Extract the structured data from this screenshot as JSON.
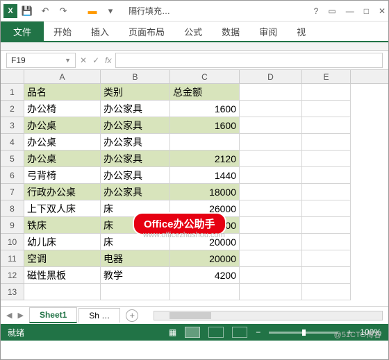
{
  "app": {
    "icon_letter": "X",
    "title": "隔行填充…"
  },
  "qat": {
    "save": "💾",
    "undo": "↶",
    "redo": "↷"
  },
  "ribbon": {
    "file": "文件",
    "tabs": [
      "开始",
      "插入",
      "页面布局",
      "公式",
      "数据",
      "审阅",
      "视"
    ]
  },
  "namebox": {
    "ref": "F19",
    "fx": "fx"
  },
  "columns": [
    "A",
    "B",
    "C",
    "D",
    "E"
  ],
  "row_nums": [
    "1",
    "2",
    "3",
    "4",
    "5",
    "6",
    "7",
    "8",
    "9",
    "10",
    "11",
    "12",
    "13"
  ],
  "headers": {
    "c1": "品名",
    "c2": "类别",
    "c3": "总金额"
  },
  "rows": [
    {
      "name": "办公椅",
      "cat": "办公家具",
      "amt": "1600",
      "shade": false
    },
    {
      "name": "办公桌",
      "cat": "办公家具",
      "amt": "1600",
      "shade": true
    },
    {
      "name": "办公桌",
      "cat": "办公家具",
      "amt": "",
      "shade": false
    },
    {
      "name": "办公桌",
      "cat": "办公家具",
      "amt": "2120",
      "shade": true
    },
    {
      "name": "弓背椅",
      "cat": "办公家具",
      "amt": "1440",
      "shade": false
    },
    {
      "name": "行政办公桌",
      "cat": "办公家具",
      "amt": "18000",
      "shade": true
    },
    {
      "name": "上下双人床",
      "cat": "床",
      "amt": "26000",
      "shade": false
    },
    {
      "name": "铁床",
      "cat": "床",
      "amt": "30000",
      "shade": true
    },
    {
      "name": "幼儿床",
      "cat": "床",
      "amt": "20000",
      "shade": false
    },
    {
      "name": "空调",
      "cat": "电器",
      "amt": "20000",
      "shade": true
    },
    {
      "name": "磁性黑板",
      "cat": "教学",
      "amt": "4200",
      "shade": false
    }
  ],
  "overlay": {
    "badge": "Office办公助手",
    "url": "www.officezhushou.com"
  },
  "sheets": {
    "active": "Sheet1",
    "other": "Sh …",
    "add": "+"
  },
  "status": {
    "ready": "就绪",
    "zoom": "100%",
    "minus": "−",
    "plus": "+"
  },
  "watermark": "@51CTO博客"
}
